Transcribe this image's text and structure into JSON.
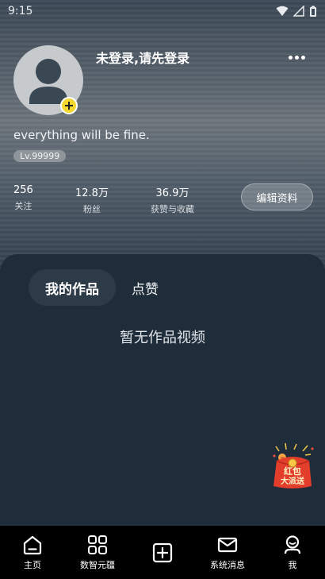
{
  "status_bar": {
    "time": "9:15"
  },
  "profile": {
    "username": "未登录,请先登录",
    "signature": "everything will be fine.",
    "level": "Lv.99999",
    "edit_label": "编辑资料"
  },
  "stats": [
    {
      "value": "256",
      "label": "关注"
    },
    {
      "value": "12.8万",
      "label": "粉丝"
    },
    {
      "value": "36.9万",
      "label": "获赞与收藏"
    }
  ],
  "tabs": [
    {
      "label": "我的作品",
      "active": true
    },
    {
      "label": "点赞",
      "active": false
    }
  ],
  "empty_state": "暂无作品视频",
  "red_packet": {
    "line1": "红包",
    "line2": "大派送"
  },
  "bottom_nav": [
    {
      "label": "主页",
      "icon": "home-icon"
    },
    {
      "label": "数智元疆",
      "icon": "grid-icon"
    },
    {
      "label": "",
      "icon": "plus-square-icon"
    },
    {
      "label": "系统消息",
      "icon": "mail-icon"
    },
    {
      "label": "我",
      "icon": "profile-icon"
    }
  ],
  "colors": {
    "accent_yellow": "#f4d82f",
    "panel_bg": "#1f2d3b",
    "nav_bg": "#000000"
  }
}
